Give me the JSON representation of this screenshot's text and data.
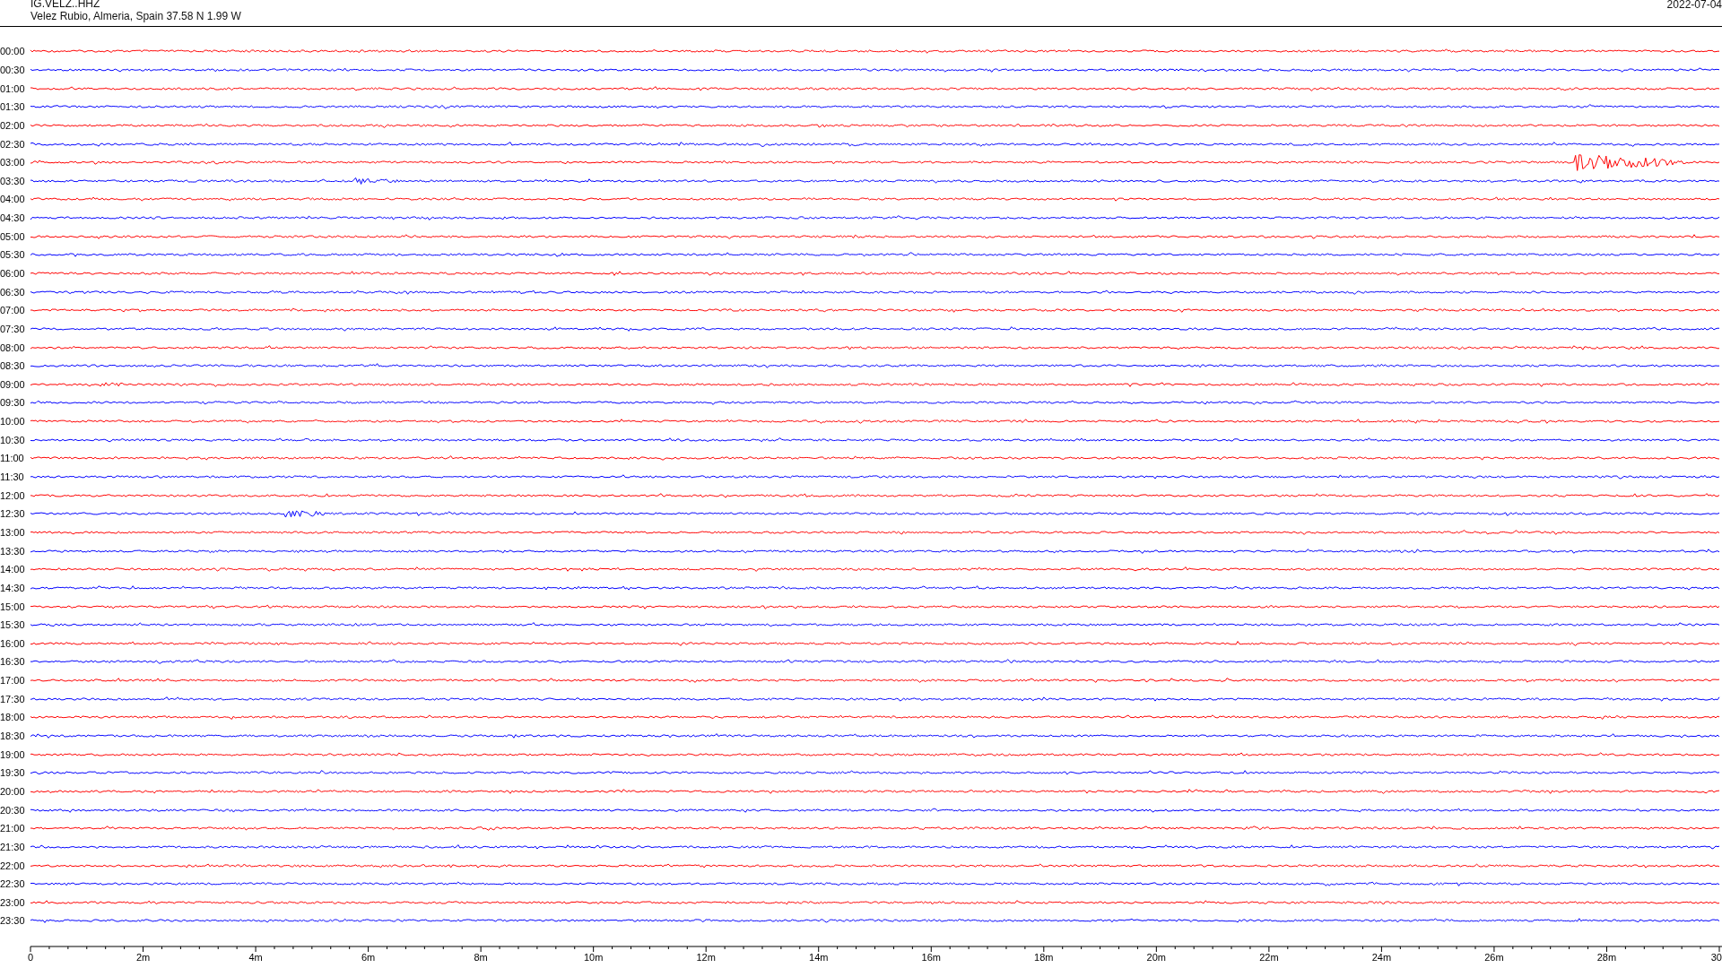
{
  "header": {
    "station": "IG.VELZ..HHZ",
    "location": "Velez Rubio, Almeria, Spain  37.58 N 1.99 W",
    "date": "2022-07-04"
  },
  "rows": [
    {
      "label": "00:00",
      "color": "#ff0000"
    },
    {
      "label": "00:30",
      "color": "#0000ff"
    },
    {
      "label": "01:00",
      "color": "#ff0000"
    },
    {
      "label": "01:30",
      "color": "#0000ff"
    },
    {
      "label": "02:00",
      "color": "#ff0000"
    },
    {
      "label": "02:30",
      "color": "#0000ff"
    },
    {
      "label": "03:00",
      "color": "#ff0000",
      "kind": "event"
    },
    {
      "label": "03:30",
      "color": "#0000ff",
      "kind": "event"
    },
    {
      "label": "04:00",
      "color": "#ff0000"
    },
    {
      "label": "04:30",
      "color": "#0000ff"
    },
    {
      "label": "05:00",
      "color": "#ff0000"
    },
    {
      "label": "05:30",
      "color": "#0000ff"
    },
    {
      "label": "06:00",
      "color": "#ff0000"
    },
    {
      "label": "06:30",
      "color": "#0000ff"
    },
    {
      "label": "07:00",
      "color": "#ff0000"
    },
    {
      "label": "07:30",
      "color": "#0000ff"
    },
    {
      "label": "08:00",
      "color": "#ff0000"
    },
    {
      "label": "08:30",
      "color": "#0000ff"
    },
    {
      "label": "09:00",
      "color": "#ff0000",
      "kind": "event"
    },
    {
      "label": "09:30",
      "color": "#0000ff"
    },
    {
      "label": "10:00",
      "color": "#ff0000"
    },
    {
      "label": "10:30",
      "color": "#0000ff",
      "kind": "event"
    },
    {
      "label": "11:00",
      "color": "#ff0000"
    },
    {
      "label": "11:30",
      "color": "#0000ff"
    },
    {
      "label": "12:00",
      "color": "#ff0000"
    },
    {
      "label": "12:30",
      "color": "#0000ff",
      "kind": "event"
    },
    {
      "label": "13:00",
      "color": "#ff0000"
    },
    {
      "label": "13:30",
      "color": "#0000ff",
      "kind": "event"
    },
    {
      "label": "14:00",
      "color": "#ff0000"
    },
    {
      "label": "14:30",
      "color": "#0000ff"
    },
    {
      "label": "15:00",
      "color": "#ff0000"
    },
    {
      "label": "15:30",
      "color": "#0000ff"
    },
    {
      "label": "16:00",
      "color": "#ff0000"
    },
    {
      "label": "16:30",
      "color": "#0000ff"
    },
    {
      "label": "17:00",
      "color": "#ff0000"
    },
    {
      "label": "17:30",
      "color": "#0000ff"
    },
    {
      "label": "18:00",
      "color": "#ff0000"
    },
    {
      "label": "18:30",
      "color": "#0000ff"
    },
    {
      "label": "19:00",
      "color": "#ff0000"
    },
    {
      "label": "19:30",
      "color": "#0000ff"
    },
    {
      "label": "20:00",
      "color": "#ff0000"
    },
    {
      "label": "20:30",
      "color": "#0000ff"
    },
    {
      "label": "21:00",
      "color": "#ff0000"
    },
    {
      "label": "21:30",
      "color": "#0000ff"
    },
    {
      "label": "22:00",
      "color": "#ff0000"
    },
    {
      "label": "22:30",
      "color": "#0000ff"
    },
    {
      "label": "23:00",
      "color": "#ff0000"
    },
    {
      "label": "23:30",
      "color": "#0000ff"
    }
  ],
  "x_axis": {
    "ticks": [
      "0",
      "2m",
      "4m",
      "6m",
      "8m",
      "10m",
      "12m",
      "14m",
      "16m",
      "18m",
      "20m",
      "22m",
      "24m",
      "26m",
      "28m",
      "30"
    ]
  }
}
